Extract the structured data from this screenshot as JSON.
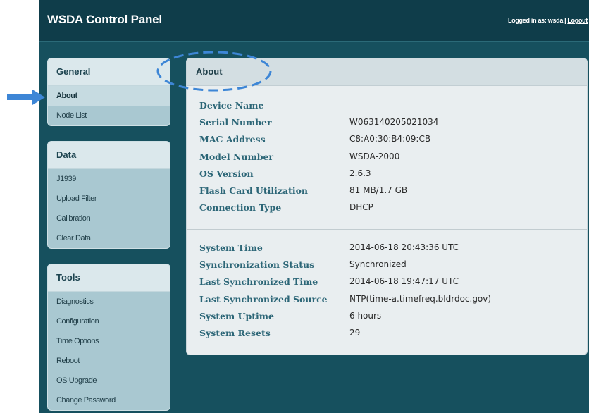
{
  "header": {
    "title": "WSDA Control Panel",
    "logged_in_text": "Logged in as: wsda",
    "separator": "|",
    "logout_label": "Logout"
  },
  "sidebar": {
    "general": {
      "title": "General",
      "items": [
        {
          "label": "About",
          "active": true
        },
        {
          "label": "Node List"
        }
      ]
    },
    "data": {
      "title": "Data",
      "items": [
        {
          "label": "J1939"
        },
        {
          "label": "Upload Filter"
        },
        {
          "label": "Calibration"
        },
        {
          "label": "Clear Data"
        }
      ]
    },
    "tools": {
      "title": "Tools",
      "items": [
        {
          "label": "Diagnostics"
        },
        {
          "label": "Configuration"
        },
        {
          "label": "Time Options"
        },
        {
          "label": "Reboot"
        },
        {
          "label": "OS Upgrade"
        },
        {
          "label": "Change Password"
        }
      ]
    }
  },
  "main": {
    "title": "About",
    "device_info": [
      {
        "label": "Device Name",
        "value": ""
      },
      {
        "label": "Serial Number",
        "value": "W063140205021034"
      },
      {
        "label": "MAC Address",
        "value": "C8:A0:30:B4:09:CB"
      },
      {
        "label": "Model Number",
        "value": "WSDA-2000"
      },
      {
        "label": "OS Version",
        "value": "2.6.3"
      },
      {
        "label": "Flash Card Utilization",
        "value": "81 MB/1.7 GB"
      },
      {
        "label": "Connection Type",
        "value": "DHCP"
      }
    ],
    "time_info": [
      {
        "label": "System Time",
        "value": "2014-06-18 20:43:36 UTC"
      },
      {
        "label": "Synchronization Status",
        "value": "Synchronized"
      },
      {
        "label": "Last Synchronized Time",
        "value": "2014-06-18 19:47:17 UTC"
      },
      {
        "label": "Last Synchronized Source",
        "value": "NTP(time-a.timefreq.bldrdoc.gov)"
      },
      {
        "label": "System Uptime",
        "value": "6 hours"
      },
      {
        "label": "System Resets",
        "value": "29"
      }
    ]
  },
  "colors": {
    "background": "#16505e",
    "topbar": "#0f3d4a",
    "annotation_blue": "#3d86d6"
  }
}
